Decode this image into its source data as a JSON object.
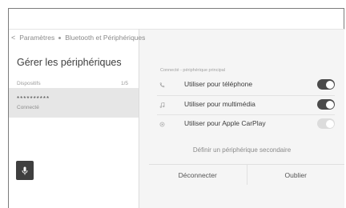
{
  "breadcrumb": {
    "back_glyph": "<",
    "parent": "Paramètres",
    "current": "Bluetooth et Périphériques"
  },
  "title": "Gérer les périphériques",
  "devices_section": {
    "label": "Dispositifs",
    "count": "1/5",
    "items": [
      {
        "name": "**********",
        "status": "Connecté"
      }
    ]
  },
  "main": {
    "sub_label": "Connecté - périphérique principal",
    "options": [
      {
        "label": "Utiliser pour téléphone",
        "icon": "phone-icon",
        "enabled": true
      },
      {
        "label": "Utiliser pour multimédia",
        "icon": "music-note-icon",
        "enabled": true
      },
      {
        "label": "Utiliser pour Apple CarPlay",
        "icon": "carplay-icon",
        "enabled": false
      }
    ],
    "secondary_link": "Définir un périphérique secondaire",
    "actions": {
      "disconnect": "Déconnecter",
      "forget": "Oublier"
    }
  },
  "mic_icon": "microphone-icon",
  "colors": {
    "toggle_on": "#4b4b4b",
    "toggle_off": "#dcdcdc",
    "selected_row": "#e6e6e6",
    "panel_bg": "#f5f5f5"
  }
}
